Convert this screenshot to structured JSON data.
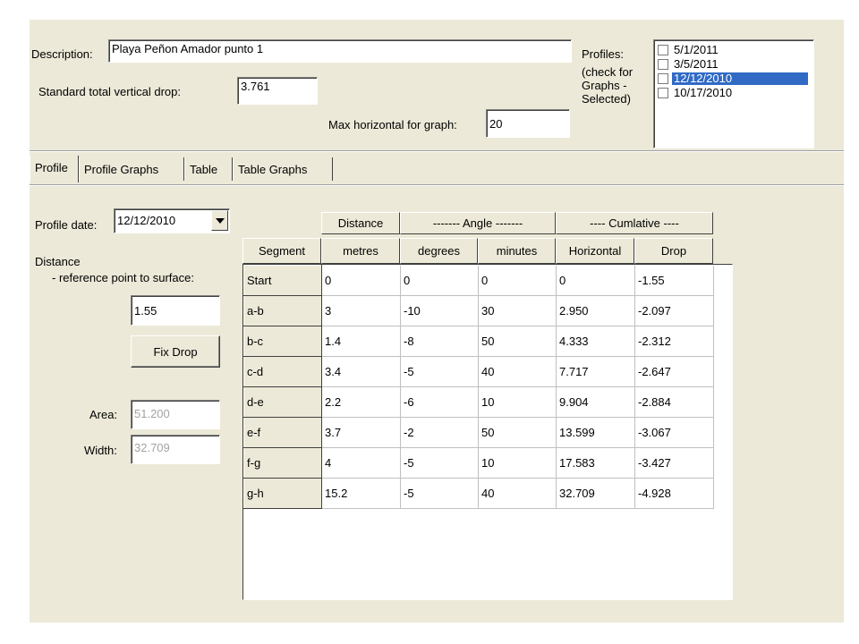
{
  "header": {
    "description_label": "Description:",
    "description_value": "Playa Peñon Amador punto 1",
    "std_drop_label": "Standard total vertical drop:",
    "std_drop_value": "3.761",
    "max_horizontal_label": "Max horizontal for graph:",
    "max_horizontal_value": "20",
    "profiles_label_lines": [
      "Profiles:",
      "(check for",
      "Graphs -",
      "Selected)"
    ],
    "profiles": [
      {
        "label": "5/1/2011",
        "checked": false,
        "selected": false
      },
      {
        "label": "3/5/2011",
        "checked": false,
        "selected": false
      },
      {
        "label": "12/12/2010",
        "checked": false,
        "selected": true
      },
      {
        "label": "10/17/2010",
        "checked": false,
        "selected": false
      }
    ]
  },
  "tabs": [
    {
      "label": "Profile",
      "active": true
    },
    {
      "label": "Profile Graphs",
      "active": false
    },
    {
      "label": "Table",
      "active": false
    },
    {
      "label": "Table Graphs",
      "active": false
    }
  ],
  "profile": {
    "date_label": "Profile date:",
    "date_value": "12/12/2010",
    "distance_label": "Distance",
    "distance_sub_label": "- reference point to surface:",
    "distance_value": "1.55",
    "fix_drop_label": "Fix Drop",
    "area_label": "Area:",
    "area_value": "51.200",
    "width_label": "Width:",
    "width_value": "32.709"
  },
  "table": {
    "group_headers": {
      "distance": "Distance",
      "angle": "------- Angle -------",
      "cumulative": "---- Cumlative ----"
    },
    "columns": [
      "Segment",
      "metres",
      "degrees",
      "minutes",
      "Horizontal",
      "Drop"
    ],
    "rows": [
      [
        "Start",
        "0",
        "0",
        "0",
        "0",
        "-1.55"
      ],
      [
        "a-b",
        "3",
        "-10",
        "30",
        "2.950",
        "-2.097"
      ],
      [
        "b-c",
        "1.4",
        "-8",
        "50",
        "4.333",
        "-2.312"
      ],
      [
        "c-d",
        "3.4",
        "-5",
        "40",
        "7.717",
        "-2.647"
      ],
      [
        "d-e",
        "2.2",
        "-6",
        "10",
        "9.904",
        "-2.884"
      ],
      [
        "e-f",
        "3.7",
        "-2",
        "50",
        "13.599",
        "-3.067"
      ],
      [
        "f-g",
        "4",
        "-5",
        "10",
        "17.583",
        "-3.427"
      ],
      [
        "g-h",
        "15.2",
        "-5",
        "40",
        "32.709",
        "-4.928"
      ]
    ]
  },
  "colors": {
    "window_bg": "#ece9d8",
    "selection": "#316ac5"
  }
}
